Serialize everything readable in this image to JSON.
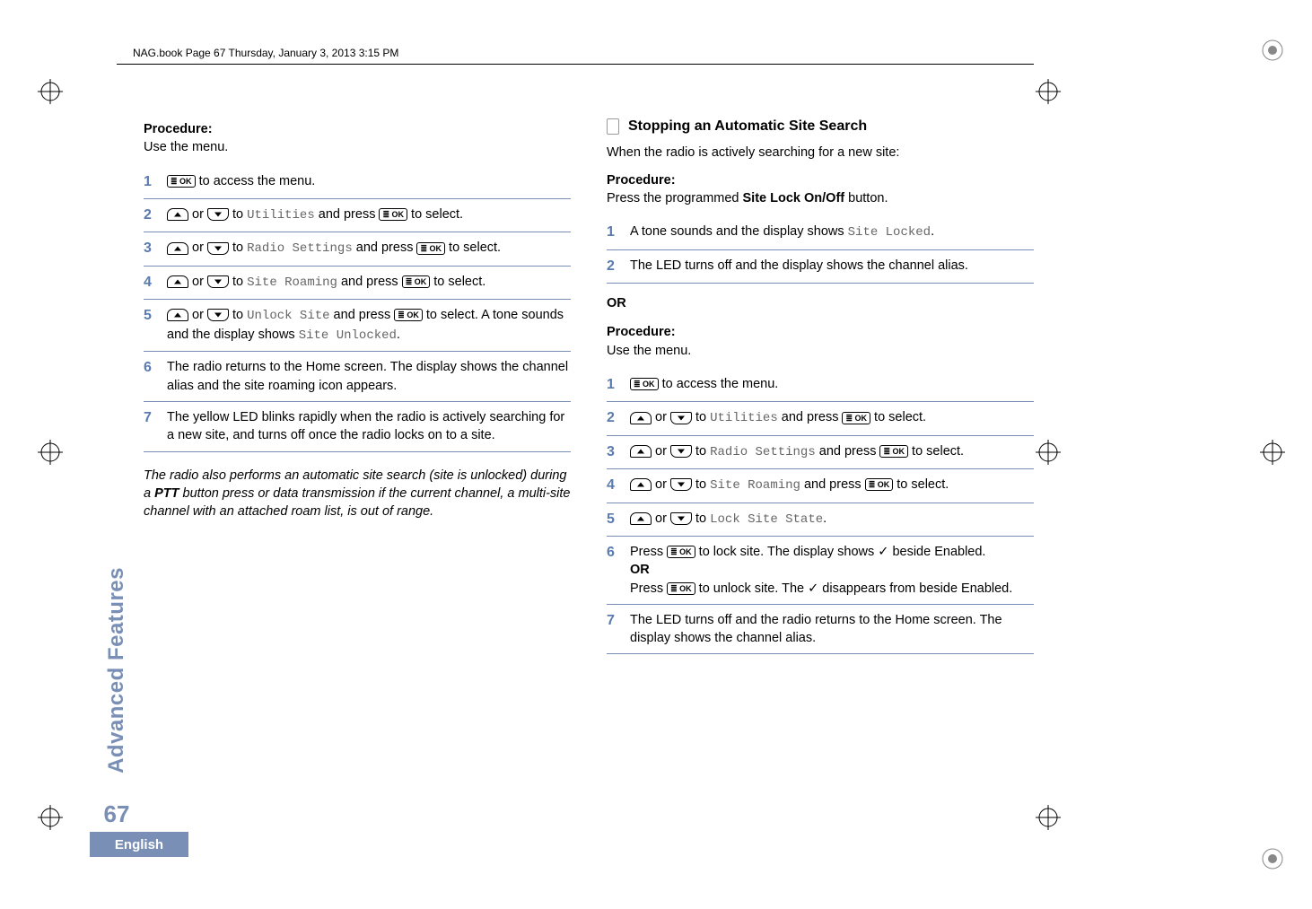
{
  "header": {
    "book_line": "NAG.book  Page 67  Thursday, January 3, 2013  3:15 PM"
  },
  "sidebar": {
    "section": "Advanced Features",
    "page_number": "67",
    "language": "English"
  },
  "left_column": {
    "procedure_label": "Procedure:",
    "procedure_sub": "Use the menu.",
    "steps": [
      {
        "n": "1",
        "pre": "",
        "btn": "ok",
        "post": " to access the menu."
      },
      {
        "n": "2",
        "pre": "",
        "arrows": true,
        "mid": " to ",
        "mono": "Utilities",
        "mid2": " and press ",
        "btn": "ok",
        "post": " to select."
      },
      {
        "n": "3",
        "pre": "",
        "arrows": true,
        "mid": " to ",
        "mono": "Radio Settings",
        "mid2": " and press ",
        "btn": "ok",
        "post": " to select."
      },
      {
        "n": "4",
        "pre": "",
        "arrows": true,
        "mid": " to ",
        "mono": "Site Roaming",
        "mid2": " and press ",
        "btn": "ok",
        "post": " to select."
      },
      {
        "n": "5",
        "pre": "",
        "arrows": true,
        "mid": " to ",
        "mono": "Unlock Site",
        "mid2": " and press ",
        "btn": "ok",
        "post": " to select. A tone sounds and the display shows ",
        "mono2": "Site Unlocked",
        "post2": "."
      },
      {
        "n": "6",
        "text": "The radio returns to the Home screen. The display shows the channel alias and the site roaming icon appears."
      },
      {
        "n": "7",
        "text": "The yellow LED blinks rapidly when the radio is actively searching for a new site, and turns off once the radio locks on to a site."
      }
    ],
    "note_pre": "The radio also performs an automatic site search (site is unlocked) during a ",
    "note_bold": "PTT",
    "note_post": " button press or data transmission if the current channel, a multi-site channel with an attached roam list, is out of range."
  },
  "right_column": {
    "heading": "Stopping an Automatic Site Search",
    "intro": "When the radio is actively searching for a new site:",
    "procedure_label": "Procedure:",
    "procedure_sub_pre": "Press the programmed ",
    "procedure_sub_bold": "Site Lock On/Off",
    "procedure_sub_post": " button.",
    "steps_a": [
      {
        "n": "1",
        "pre": "A tone sounds and the display shows ",
        "mono": "Site Locked",
        "post": "."
      },
      {
        "n": "2",
        "text": "The LED turns off and the display shows the channel alias."
      }
    ],
    "or_label": "OR",
    "procedure2_label": "Procedure:",
    "procedure2_sub": "Use the menu.",
    "steps_b": [
      {
        "n": "1",
        "btn": "ok",
        "post": " to access the menu."
      },
      {
        "n": "2",
        "arrows": true,
        "mid": " to ",
        "mono": "Utilities",
        "mid2": " and press ",
        "btn": "ok",
        "post": " to select."
      },
      {
        "n": "3",
        "arrows": true,
        "mid": " to ",
        "mono": "Radio Settings",
        "mid2": " and press ",
        "btn": "ok",
        "post": " to select."
      },
      {
        "n": "4",
        "arrows": true,
        "mid": " to ",
        "mono": "Site Roaming",
        "mid2": " and press ",
        "btn": "ok",
        "post": " to select."
      },
      {
        "n": "5",
        "arrows": true,
        "mid": " to ",
        "mono": "Lock Site State",
        "post": "."
      },
      {
        "n": "6",
        "line1_pre": "Press ",
        "line1_btn": "ok",
        "line1_post": " to lock site. The display shows ✓ beside Enabled.",
        "or": "OR",
        "line2_pre": "Press ",
        "line2_btn": "ok",
        "line2_post": " to unlock site. The ✓ disappears from beside Enabled."
      },
      {
        "n": "7",
        "text": "The LED turns off and the radio returns to the Home screen. The display shows the channel alias."
      }
    ]
  },
  "icons": {
    "ok_label": "≣ OK"
  }
}
